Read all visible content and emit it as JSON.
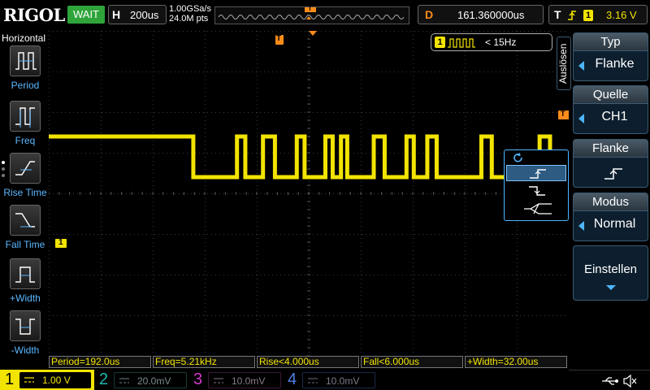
{
  "header": {
    "brand": "RIGOL",
    "run_state": "WAIT",
    "timebase_letter": "H",
    "timebase_value": "200us",
    "sample_rate": "1.00GSa/s",
    "memory_depth": "24.0M pts",
    "delay_letter": "D",
    "delay_value": "161.360000us",
    "trigger_letter": "T",
    "trigger_channel": "1",
    "trigger_level": "3.16 V"
  },
  "display": {
    "trigger_marker": "T",
    "ch1_marker": "1",
    "freq_badge_channel": "1",
    "freq_badge_text": "< 15Hz",
    "waveform": {
      "channel": "1",
      "high_level_div": 2.6,
      "low_level_div": 3.6,
      "transitions_div": [
        2.78,
        3.62,
        3.78,
        4.12,
        4.35,
        4.77,
        4.92,
        5.32,
        5.46,
        5.62,
        5.74,
        6.25,
        6.46,
        6.88,
        7.02,
        7.28,
        7.46,
        8.32,
        8.52,
        9.44,
        9.64
      ]
    },
    "colors": {
      "ch1": "#f2e400",
      "ch2": "#1fb8b0",
      "ch3": "#d23acb",
      "ch4": "#4f7fe0",
      "accent": "#4fb6ff",
      "trigger": "#ff8c1a",
      "run_state_bg": "#2ea43a"
    }
  },
  "left_menu": {
    "title": "Horizontal",
    "items": [
      {
        "label": "Period",
        "icon": "period-icon"
      },
      {
        "label": "Freq",
        "icon": "freq-icon"
      },
      {
        "label": "Rise Time",
        "icon": "rise-time-icon"
      },
      {
        "label": "Fall Time",
        "icon": "fall-time-icon"
      },
      {
        "label": "+Width",
        "icon": "positive-width-icon"
      },
      {
        "label": "-Width",
        "icon": "negative-width-icon"
      }
    ]
  },
  "right_menu": {
    "tab": "Auslösen",
    "items": [
      {
        "title": "Typ",
        "value": "Flanke"
      },
      {
        "title": "Quelle",
        "value": "CH1"
      },
      {
        "title": "Flanke",
        "value": ""
      },
      {
        "title": "Modus",
        "value": "Normal"
      },
      {
        "title": "Einstellen",
        "value": ""
      }
    ]
  },
  "measurements": [
    "Period=192.0us",
    "Freq=5.21kHz",
    "Rise<4.000us",
    "Fall<6.000us",
    "+Width=32.00us"
  ],
  "channels": [
    {
      "num": "1",
      "scale": "1.00 V"
    },
    {
      "num": "2",
      "scale": "20.0mV"
    },
    {
      "num": "3",
      "scale": "10.0mV"
    },
    {
      "num": "4",
      "scale": "10.0mV"
    }
  ]
}
